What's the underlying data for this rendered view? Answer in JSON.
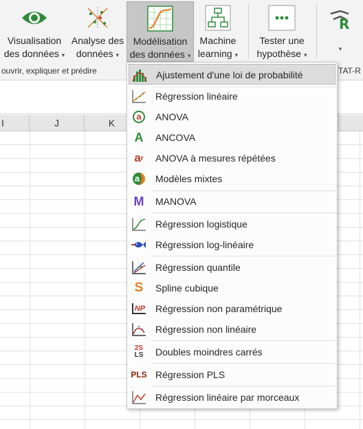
{
  "ribbon": {
    "buttons": [
      {
        "line1": "Visualisation",
        "line2": "des données",
        "icon": "eye-icon"
      },
      {
        "line1": "Analyse des",
        "line2": "données",
        "icon": "scatter-analysis-icon"
      },
      {
        "line1": "Modélisation",
        "line2": "des données",
        "icon": "model-curve-icon"
      },
      {
        "line1": "Machine",
        "line2": "learning",
        "icon": "network-tree-icon"
      },
      {
        "line1": "Tester une",
        "line2": "hypothèse",
        "icon": "hypothesis-dots-icon"
      }
    ],
    "caret": "▾",
    "group_label": "ouvrir, expliquer et prédire",
    "right_label": "TAT-R"
  },
  "sheet": {
    "columns": [
      "I",
      "J",
      "K"
    ]
  },
  "menu": {
    "items": [
      {
        "label": "Ajustement d'une loi de probabilité",
        "icon": "distribution-fit-icon",
        "highlighted": true
      },
      {
        "label": "Régression linéaire",
        "icon": "linear-regression-icon"
      },
      {
        "label": "ANOVA",
        "icon": "anova-icon"
      },
      {
        "label": "ANCOVA",
        "icon": "ancova-icon"
      },
      {
        "label": "ANOVA à mesures répétées",
        "icon": "repeated-measures-anova-icon"
      },
      {
        "label": "Modèles mixtes",
        "icon": "mixed-models-icon"
      },
      {
        "label": "MANOVA",
        "icon": "manova-icon"
      },
      {
        "label": "Régression logistique",
        "icon": "logistic-regression-icon"
      },
      {
        "label": "Régression log-linéaire",
        "icon": "log-linear-fish-icon"
      },
      {
        "label": "Régression quantile",
        "icon": "quantile-regression-icon"
      },
      {
        "label": "Spline cubique",
        "icon": "cubic-spline-icon"
      },
      {
        "label": "Régression non paramétrique",
        "icon": "nonparametric-regression-icon"
      },
      {
        "label": "Régression non linéaire",
        "icon": "nonlinear-regression-icon"
      },
      {
        "label": "Doubles moindres carrés",
        "icon": "two-stage-least-squares-icon"
      },
      {
        "label": "Régression PLS",
        "icon": "pls-regression-icon"
      },
      {
        "label": "Régression linéaire par morceaux",
        "icon": "piecewise-regression-icon"
      }
    ],
    "icon_text": {
      "anova": "a",
      "ancova": "A",
      "repeated": "a",
      "repeated_sup": "r",
      "mixed": "a",
      "manova": "M",
      "spline": "S",
      "np": "NP",
      "dls_top": "2S",
      "dls_bottom": "LS",
      "pls": "PLS"
    }
  }
}
